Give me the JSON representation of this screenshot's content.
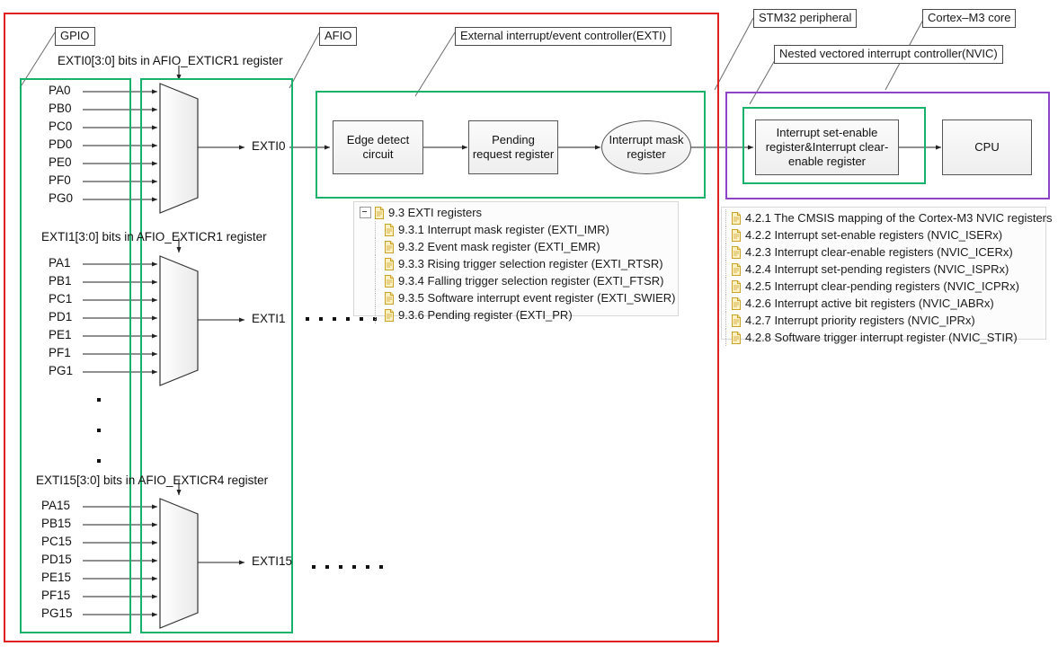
{
  "diagram": {
    "title": "STM32 EXTI / NVIC interrupt path block diagram",
    "colors": {
      "stm32_peripheral_border": "#e02020",
      "block_border": "#18b26b",
      "cortex_core_border": "#8e44c7"
    }
  },
  "callouts": {
    "gpio": "GPIO",
    "afio": "AFIO",
    "exti": "External interrupt/event controller(EXTI)",
    "stm32_peripheral": "STM32 peripheral",
    "nvic": "Nested vectored interrupt controller(NVIC)",
    "cortex_m3": "Cortex–M3 core"
  },
  "gpio_groups": [
    {
      "caption": "EXTI0[3:0] bits in AFIO_EXTICR1 register",
      "pins": [
        "PA0",
        "PB0",
        "PC0",
        "PD0",
        "PE0",
        "PF0",
        "PG0"
      ],
      "output": "EXTI0"
    },
    {
      "caption": "EXTI1[3:0] bits in AFIO_EXTICR1 register",
      "pins": [
        "PA1",
        "PB1",
        "PC1",
        "PD1",
        "PE1",
        "PF1",
        "PG1"
      ],
      "output": "EXTI1"
    },
    {
      "caption": "EXTI15[3:0] bits in AFIO_EXTICR4 register",
      "pins": [
        "PA15",
        "PB15",
        "PC15",
        "PD15",
        "PE15",
        "PF15",
        "PG15"
      ],
      "output": "EXTI15"
    }
  ],
  "exti_blocks": {
    "edge_detect": "Edge  detect\ncircuit",
    "edge_detect_line1": "Edge  detect",
    "edge_detect_line2": "circuit",
    "pending_line1": "Pending",
    "pending_line2": "request register",
    "mask_line1": "Interrupt mask",
    "mask_line2": "register"
  },
  "nvic_blocks": {
    "set_clear_line1": "Interrupt set-enable",
    "set_clear_line2": "register&Interrupt clear-",
    "set_clear_line3": "enable  register",
    "cpu": "CPU"
  },
  "exti_tree": {
    "root": "9.3 EXTI registers",
    "items": [
      "9.3.1 Interrupt mask register (EXTI_IMR)",
      "9.3.2 Event mask register (EXTI_EMR)",
      "9.3.3 Rising trigger selection register (EXTI_RTSR)",
      "9.3.4 Falling trigger selection register (EXTI_FTSR)",
      "9.3.5 Software interrupt event register (EXTI_SWIER)",
      "9.3.6 Pending register (EXTI_PR)"
    ]
  },
  "nvic_tree": {
    "items": [
      "4.2.1 The CMSIS mapping of the Cortex-M3 NVIC registers",
      "4.2.2 Interrupt set-enable registers (NVIC_ISERx)",
      "4.2.3 Interrupt clear-enable registers (NVIC_ICERx)",
      "4.2.4 Interrupt set-pending registers (NVIC_ISPRx)",
      "4.2.5 Interrupt clear-pending registers (NVIC_ICPRx)",
      "4.2.6 Interrupt active bit registers (NVIC_IABRx)",
      "4.2.7 Interrupt priority registers (NVIC_IPRx)",
      "4.2.8 Software trigger interrupt register (NVIC_STIR)"
    ]
  },
  "icons": {
    "document": "document-icon",
    "expander": "tree-collapse-icon"
  }
}
